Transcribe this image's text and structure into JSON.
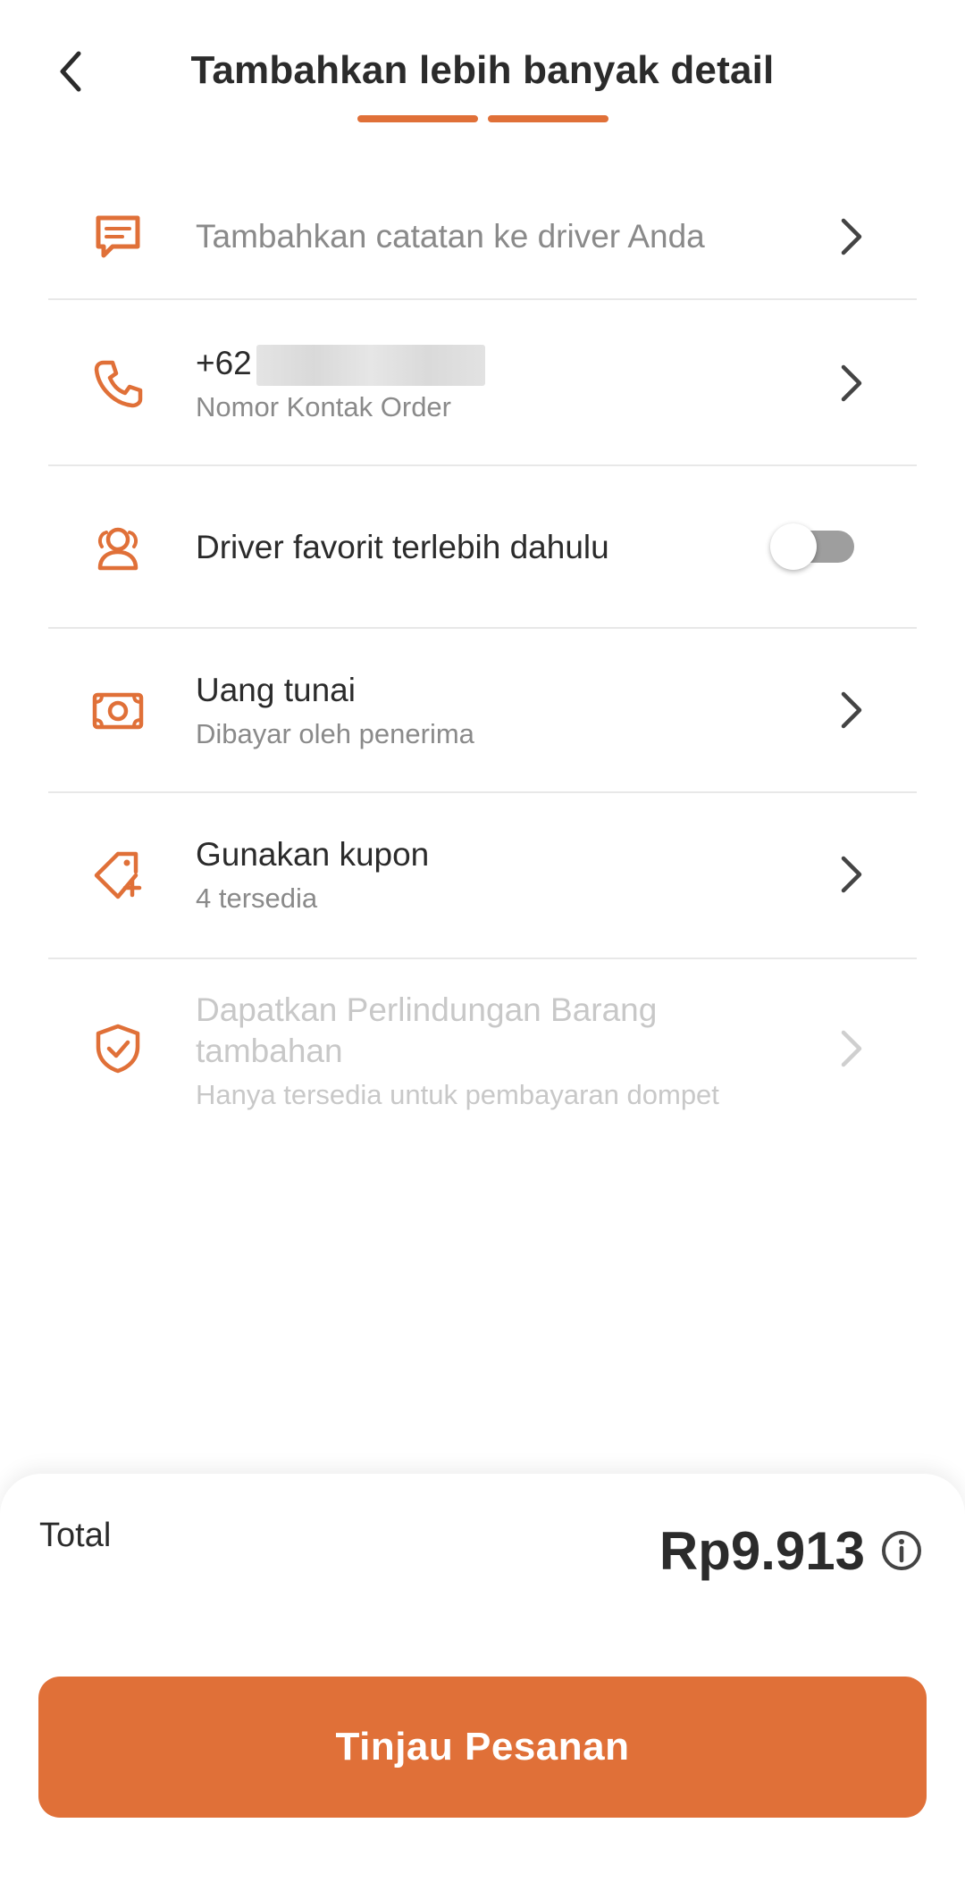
{
  "header": {
    "title": "Tambahkan lebih banyak detail"
  },
  "rows": [
    {
      "title": "Tambahkan catatan ke driver Anda"
    },
    {
      "title": "+62",
      "subtitle": "Nomor Kontak Order"
    },
    {
      "title": "Driver favorit terlebih dahulu",
      "toggle_on": false
    },
    {
      "title": "Uang tunai",
      "subtitle": "Dibayar oleh penerima"
    },
    {
      "title": "Gunakan kupon",
      "subtitle": "4 tersedia"
    },
    {
      "title_line1": "Dapatkan Perlindungan Barang",
      "title_line2": "tambahan",
      "subtitle": "Hanya tersedia untuk pembayaran dompet",
      "disabled": true
    }
  ],
  "footer": {
    "total_label": "Total",
    "total_amount": "Rp9.913",
    "cta_label": "Tinjau Pesanan"
  },
  "colors": {
    "accent": "#E07038",
    "text": "#2b2b2b",
    "muted": "#8a8a8a",
    "disabled": "#c8c8c8"
  },
  "icons": [
    "chevron-left-icon",
    "note-icon",
    "phone-icon",
    "favorite-driver-icon",
    "cash-icon",
    "coupon-icon",
    "shield-check-icon",
    "chevron-right-icon",
    "info-icon"
  ]
}
